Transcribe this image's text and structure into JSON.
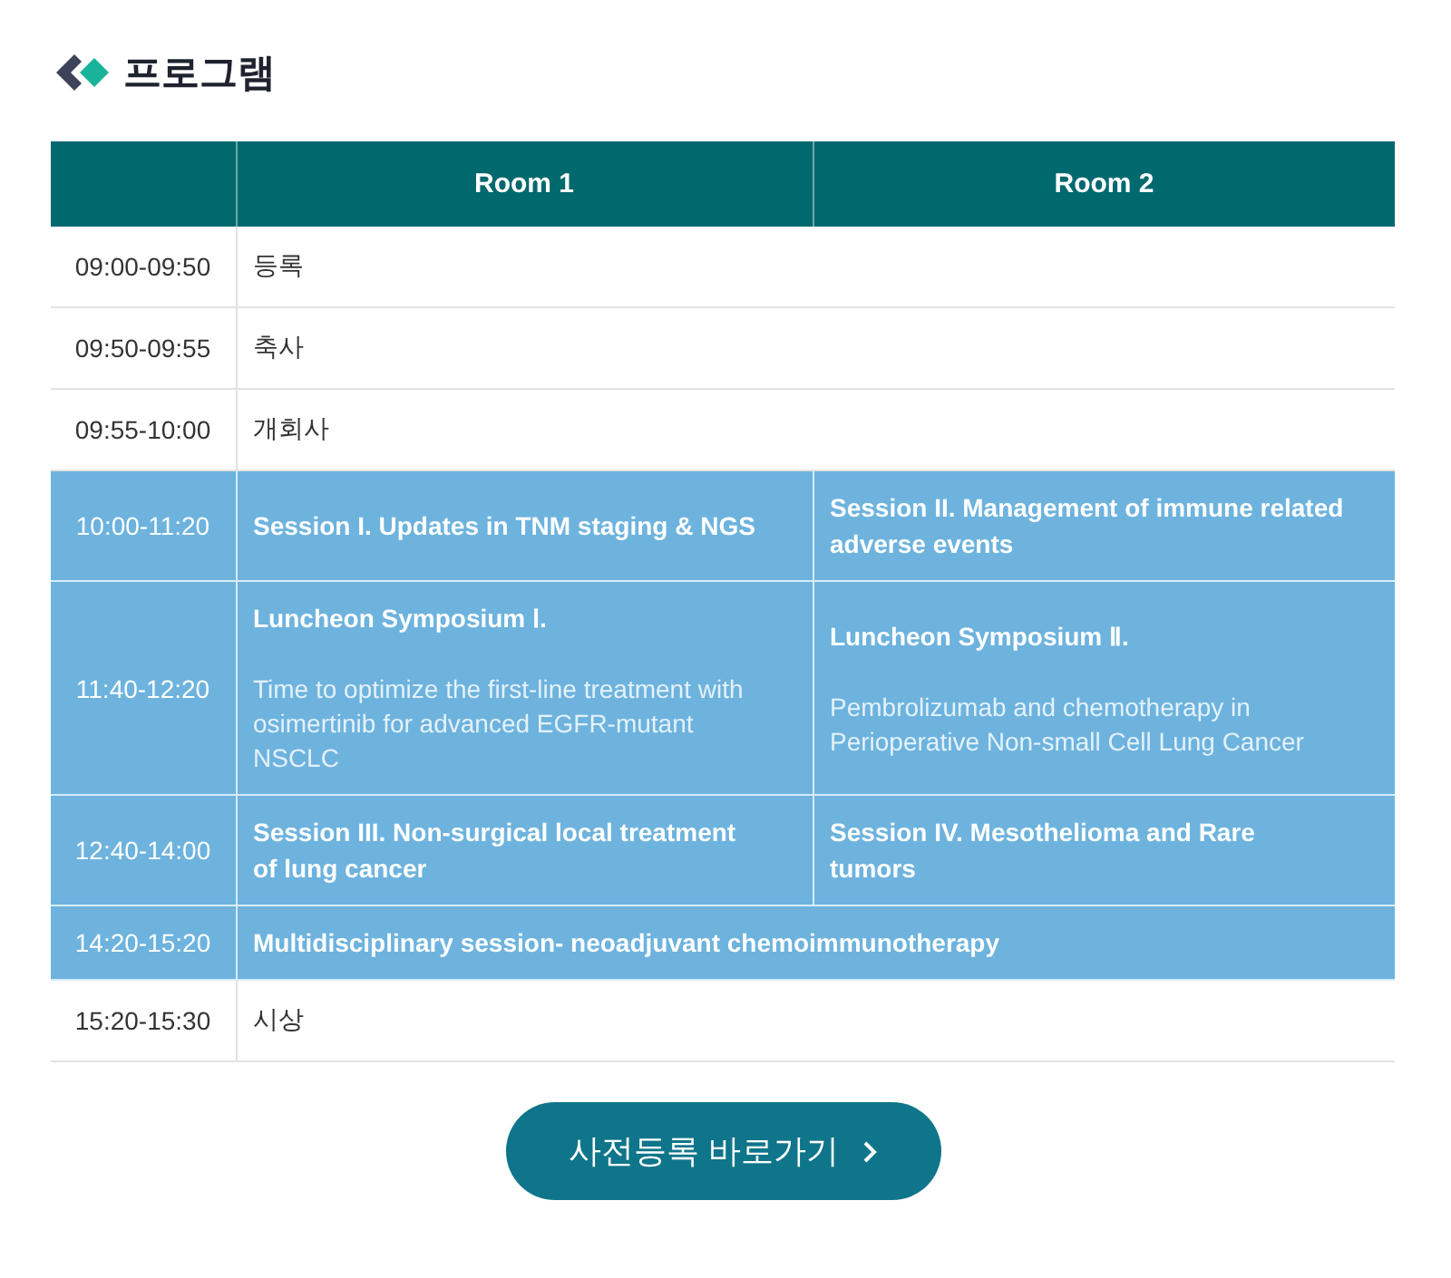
{
  "heading": "프로그램",
  "table": {
    "columns": [
      "",
      "Room 1",
      "Room 2"
    ],
    "rows": [
      {
        "highlighted": false,
        "cells": [
          {
            "title": "09:00-09:50"
          },
          {
            "title": "등록",
            "colspan": 2
          }
        ]
      },
      {
        "highlighted": false,
        "cells": [
          {
            "title": "09:50-09:55"
          },
          {
            "title": "축사",
            "colspan": 2
          }
        ]
      },
      {
        "highlighted": false,
        "cells": [
          {
            "title": "09:55-10:00"
          },
          {
            "title": "개회사",
            "colspan": 2
          }
        ]
      },
      {
        "highlighted": true,
        "cells": [
          {
            "title": "10:00-11:20"
          },
          {
            "title": "Session I. Updates in TNM staging & NGS"
          },
          {
            "title": "Session II. Management of immune related adverse events"
          }
        ]
      },
      {
        "highlighted": true,
        "cells": [
          {
            "title": "11:40-12:20"
          },
          {
            "title": "Luncheon Symposium Ⅰ.",
            "subtitle": "Time to optimize the first-line treatment with osimertinib for advanced EGFR-mutant NSCLC"
          },
          {
            "title": "Luncheon Symposium Ⅱ.",
            "subtitle": "Pembrolizumab and chemotherapy in Perioperative Non-small Cell Lung Cancer"
          }
        ]
      },
      {
        "highlighted": true,
        "cells": [
          {
            "title": "12:40-14:00"
          },
          {
            "title": "Session III. Non-surgical local treatment of lung cancer"
          },
          {
            "title": "Session IV. Mesothelioma and Rare tumors"
          }
        ]
      },
      {
        "highlighted": true,
        "cells": [
          {
            "title": "14:20-15:20"
          },
          {
            "title": "Multidisciplinary  session- neoadjuvant chemoimmunotherapy",
            "colspan": 2
          }
        ]
      },
      {
        "highlighted": false,
        "cells": [
          {
            "title": "15:20-15:30"
          },
          {
            "title": "시상",
            "colspan": 2
          }
        ]
      }
    ]
  },
  "button": {
    "label": "사전등록 바로가기"
  }
}
